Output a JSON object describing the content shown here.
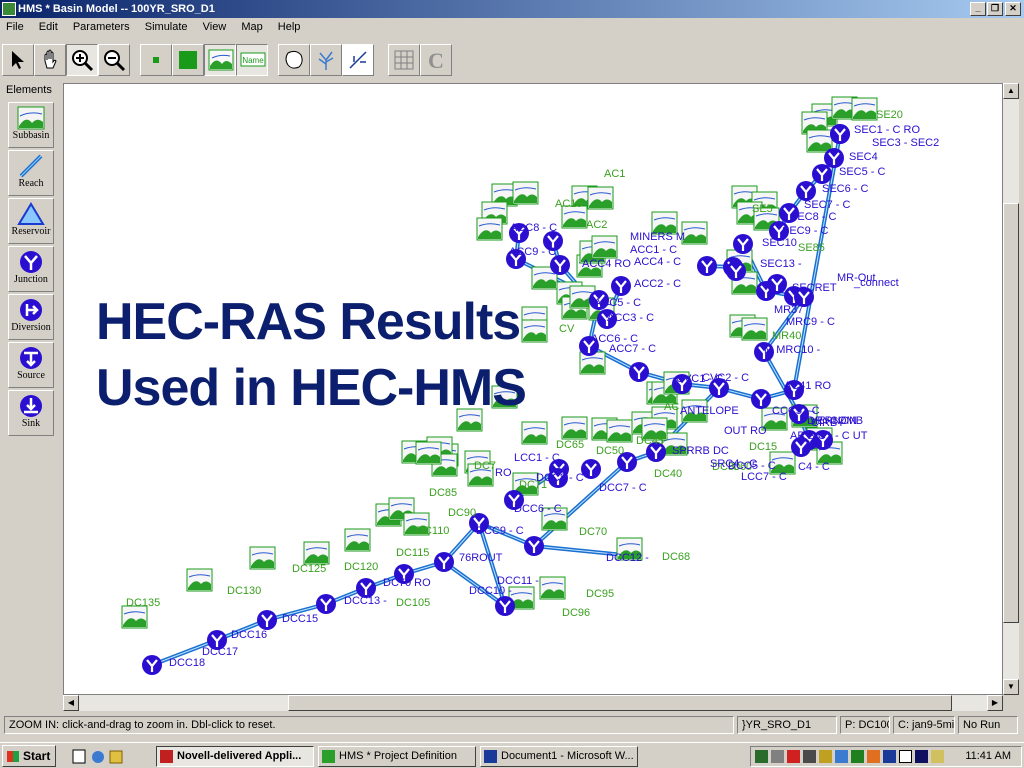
{
  "window": {
    "title": "HMS * Basin Model -- 100YR_SRO_D1",
    "minimize_label": "_",
    "restore_label": "❐",
    "close_label": "✕"
  },
  "menu": [
    "File",
    "Edit",
    "Parameters",
    "Simulate",
    "View",
    "Map",
    "Help"
  ],
  "toolbar": {
    "tools": [
      "select-arrow",
      "pan-hand",
      "zoom-in",
      "zoom-out",
      "small-square",
      "large-square",
      "subbasin-image",
      "name-label",
      "outline",
      "tree",
      "reach-arrows",
      "grid",
      "refresh-c"
    ],
    "name_label": "Name",
    "c_label": "C"
  },
  "palette": {
    "title": "Elements",
    "items": [
      {
        "label": "Subbasin",
        "icon": "subbasin-icon"
      },
      {
        "label": "Reach",
        "icon": "reach-icon"
      },
      {
        "label": "Reservoir",
        "icon": "reservoir-icon"
      },
      {
        "label": "Junction",
        "icon": "junction-icon"
      },
      {
        "label": "Diversion",
        "icon": "diversion-icon"
      },
      {
        "label": "Source",
        "icon": "source-icon"
      },
      {
        "label": "Sink",
        "icon": "sink-icon"
      }
    ]
  },
  "overlay": {
    "line1": "HEC-RAS Results",
    "line2": "Used in HEC-HMS"
  },
  "map": {
    "green_labels": [
      "AC1",
      "AC15",
      "AC2",
      "SE20",
      "SE5",
      "SE85",
      "CV",
      "MR40",
      "AC",
      "DC65",
      "DC50",
      "DC45",
      "DC15",
      "DC40",
      "DC7",
      "DC71",
      "DC85",
      "DC90",
      "DC110",
      "DC115",
      "DC120",
      "DC125",
      "DC130",
      "DC135",
      "DC105",
      "DC70",
      "DC68",
      "DC95",
      "DC96",
      "DC80",
      "C60"
    ],
    "blue_labels": [
      "SEC1 - C RO",
      "SEC3 - SEC2",
      "SEC4",
      "SEC5 - C",
      "SEC6 - C",
      "SEC7 - C",
      "SEC8 - C",
      "SEC9 - C",
      "SEC10",
      "SEC13 -",
      "MR-Out",
      "SECRET",
      "_connect",
      "MR37",
      "MRC9 - C",
      "M MRC10 -",
      "MINERS M",
      "ACC1 - C",
      "ACC4 - C",
      "ACC4 RO",
      "ACC2 - C",
      "ACC5 - C",
      "ACC3 - C",
      "ACC6 - C",
      "ACC7 - C",
      "ACC8 - C",
      "ACC9 - C",
      "CVC1 - C",
      "CVC2 - C",
      "AC41 RO",
      "ANTELOPE",
      "CCC5 - C",
      "DRYCOMB",
      "CIRBY",
      "AP S C1 - C UT",
      "VERNON",
      "OUT RO",
      "SPRRB DC",
      "SRC4 - C",
      "DCC5 - C",
      "C4 - C",
      "LCC7 - C",
      "LCC1 - C",
      "RO",
      "DCC7 - C",
      "DCC8 - C",
      "DCC6 - C",
      "DCC9 - C",
      "76ROUT",
      "DCC11 -",
      "DCC12 -",
      "DCC10 -",
      "DC70 RO",
      "DCC13 -",
      "DCC15",
      "DCC16",
      "DCC17",
      "DCC18",
      "CANAL RO",
      "MOUTHDCC"
    ]
  },
  "status": {
    "message": "ZOOM IN: click-and-drag to zoom in.  Dbl-click to reset.",
    "field2": "}YR_SRO_D1",
    "field3": "P: DC100",
    "field4": "C: jan9-5min",
    "field5": "No Run"
  },
  "taskbar": {
    "start": "Start",
    "tasks": [
      "Novell-delivered Appli...",
      "HMS * Project Definition",
      "Document1 - Microsoft W..."
    ],
    "clock": "11:41 AM"
  },
  "colors": {
    "titlebar_start": "#0a246a",
    "titlebar_end": "#a6caf0",
    "overlay_text": "#0c1f6e",
    "junction": "#2a0fd0",
    "reach": "#1a70d0",
    "green_label": "#3aa020"
  }
}
